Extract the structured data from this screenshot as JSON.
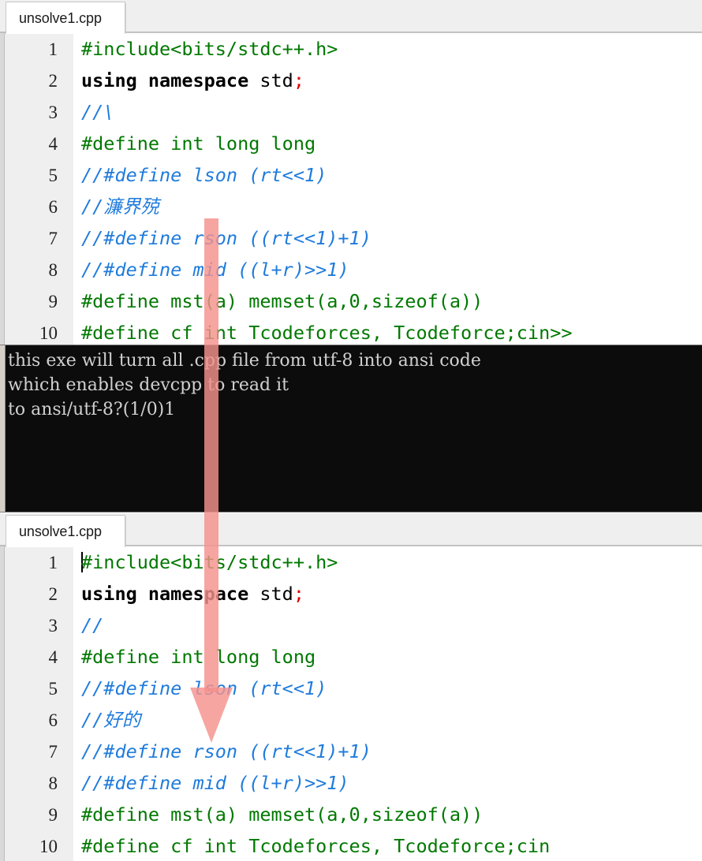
{
  "top_editor": {
    "tab": {
      "label": "unsolve1.cpp"
    },
    "lines": [
      {
        "n": "1",
        "segments": [
          {
            "t": "pp",
            "x": "#include<bits/stdc++.h>"
          }
        ]
      },
      {
        "n": "2",
        "segments": [
          {
            "t": "kw",
            "x": "using namespace"
          },
          {
            "t": "id",
            "x": " std"
          },
          {
            "t": "semi",
            "x": ";"
          }
        ]
      },
      {
        "n": "3",
        "segments": [
          {
            "t": "cmt",
            "x": "//\\"
          }
        ]
      },
      {
        "n": "4",
        "segments": [
          {
            "t": "pp",
            "x": "#define int long long"
          }
        ]
      },
      {
        "n": "5",
        "segments": [
          {
            "t": "cmt",
            "x": "//#define lson (rt<<1)"
          }
        ]
      },
      {
        "n": "6",
        "segments": [
          {
            "t": "cmt",
            "x": "//"
          },
          {
            "t": "cjk",
            "x": "濂界殑"
          }
        ]
      },
      {
        "n": "7",
        "segments": [
          {
            "t": "cmt",
            "x": "//#define rson ((rt<<1)+1)"
          }
        ]
      },
      {
        "n": "8",
        "segments": [
          {
            "t": "cmt",
            "x": "//#define mid ((l+r)>>1)"
          }
        ]
      },
      {
        "n": "9",
        "segments": [
          {
            "t": "pp",
            "x": "#define mst(a) memset(a,0,sizeof(a))"
          }
        ]
      },
      {
        "n": "10",
        "segments": [
          {
            "t": "pp",
            "x": "#define cf int Tcodeforces, Tcodeforce;cin>>"
          }
        ]
      }
    ]
  },
  "console": {
    "lines": [
      "this exe will turn all .cpp file from utf-8 into ansi code",
      "which enables devcpp to read it",
      "to ansi/utf-8?(1/0)1"
    ]
  },
  "bottom_editor": {
    "tab": {
      "label": "unsolve1.cpp"
    },
    "lines": [
      {
        "n": "1",
        "caret": true,
        "segments": [
          {
            "t": "pp",
            "x": "#include<bits/stdc++.h>"
          }
        ]
      },
      {
        "n": "2",
        "segments": [
          {
            "t": "kw",
            "x": "using namespace"
          },
          {
            "t": "id",
            "x": " std"
          },
          {
            "t": "semi",
            "x": ";"
          }
        ]
      },
      {
        "n": "3",
        "segments": [
          {
            "t": "cmt",
            "x": "//"
          }
        ]
      },
      {
        "n": "4",
        "segments": [
          {
            "t": "pp",
            "x": "#define int long long"
          }
        ]
      },
      {
        "n": "5",
        "segments": [
          {
            "t": "cmt",
            "x": "//#define lson (rt<<1)"
          }
        ]
      },
      {
        "n": "6",
        "segments": [
          {
            "t": "cmt",
            "x": "//"
          },
          {
            "t": "cjk",
            "x": "好的"
          }
        ]
      },
      {
        "n": "7",
        "segments": [
          {
            "t": "cmt",
            "x": "//#define rson ((rt<<1)+1)"
          }
        ]
      },
      {
        "n": "8",
        "segments": [
          {
            "t": "cmt",
            "x": "//#define mid ((l+r)>>1)"
          }
        ]
      },
      {
        "n": "9",
        "segments": [
          {
            "t": "pp",
            "x": "#define mst(a) memset(a,0,sizeof(a))"
          }
        ]
      },
      {
        "n": "10",
        "segments": [
          {
            "t": "pp",
            "x": "#define cf int Tcodeforces, Tcodeforce;cin"
          }
        ]
      }
    ]
  },
  "annotation": {
    "arrow_color": "#f4918c",
    "direction": "down"
  }
}
